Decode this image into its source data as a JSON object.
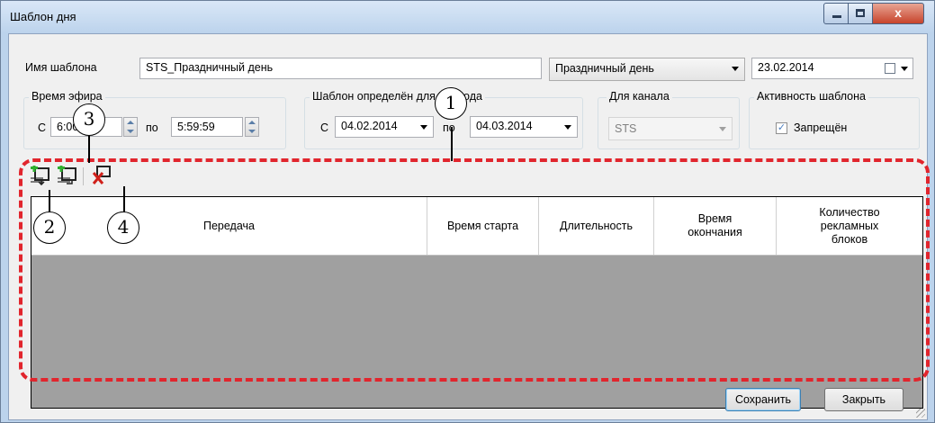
{
  "window": {
    "title": "Шаблон дня",
    "close_glyph": "x"
  },
  "form": {
    "name_label": "Имя шаблона",
    "name_value": "STS_Праздничный день",
    "type_value": "Праздничный день",
    "date_value": "23.02.2014",
    "airtime_group": "Время эфира",
    "from_label": "С",
    "from_time": "6:00:00",
    "to_label": "по",
    "to_time": "5:59:59",
    "period_group": "Шаблон определён для периода",
    "period_from_label": "С",
    "period_from": "04.02.2014",
    "period_to_label": "по",
    "period_to": "04.03.2014",
    "channel_group": "Для канала",
    "channel_value": "STS",
    "activity_group": "Активность шаблона",
    "forbidden_label": "Запрещён",
    "forbidden_checked": "✓"
  },
  "grid": {
    "columns": [
      "Передача",
      "Время старта",
      "Длительность",
      "Время окончания",
      "Количество рекламных блоков"
    ]
  },
  "buttons": {
    "save": "Сохранить",
    "close": "Закрыть"
  },
  "callouts": [
    "1",
    "2",
    "3",
    "4"
  ],
  "colors": {
    "highlight": "#e1252d",
    "grid_body": "#a0a0a0"
  }
}
